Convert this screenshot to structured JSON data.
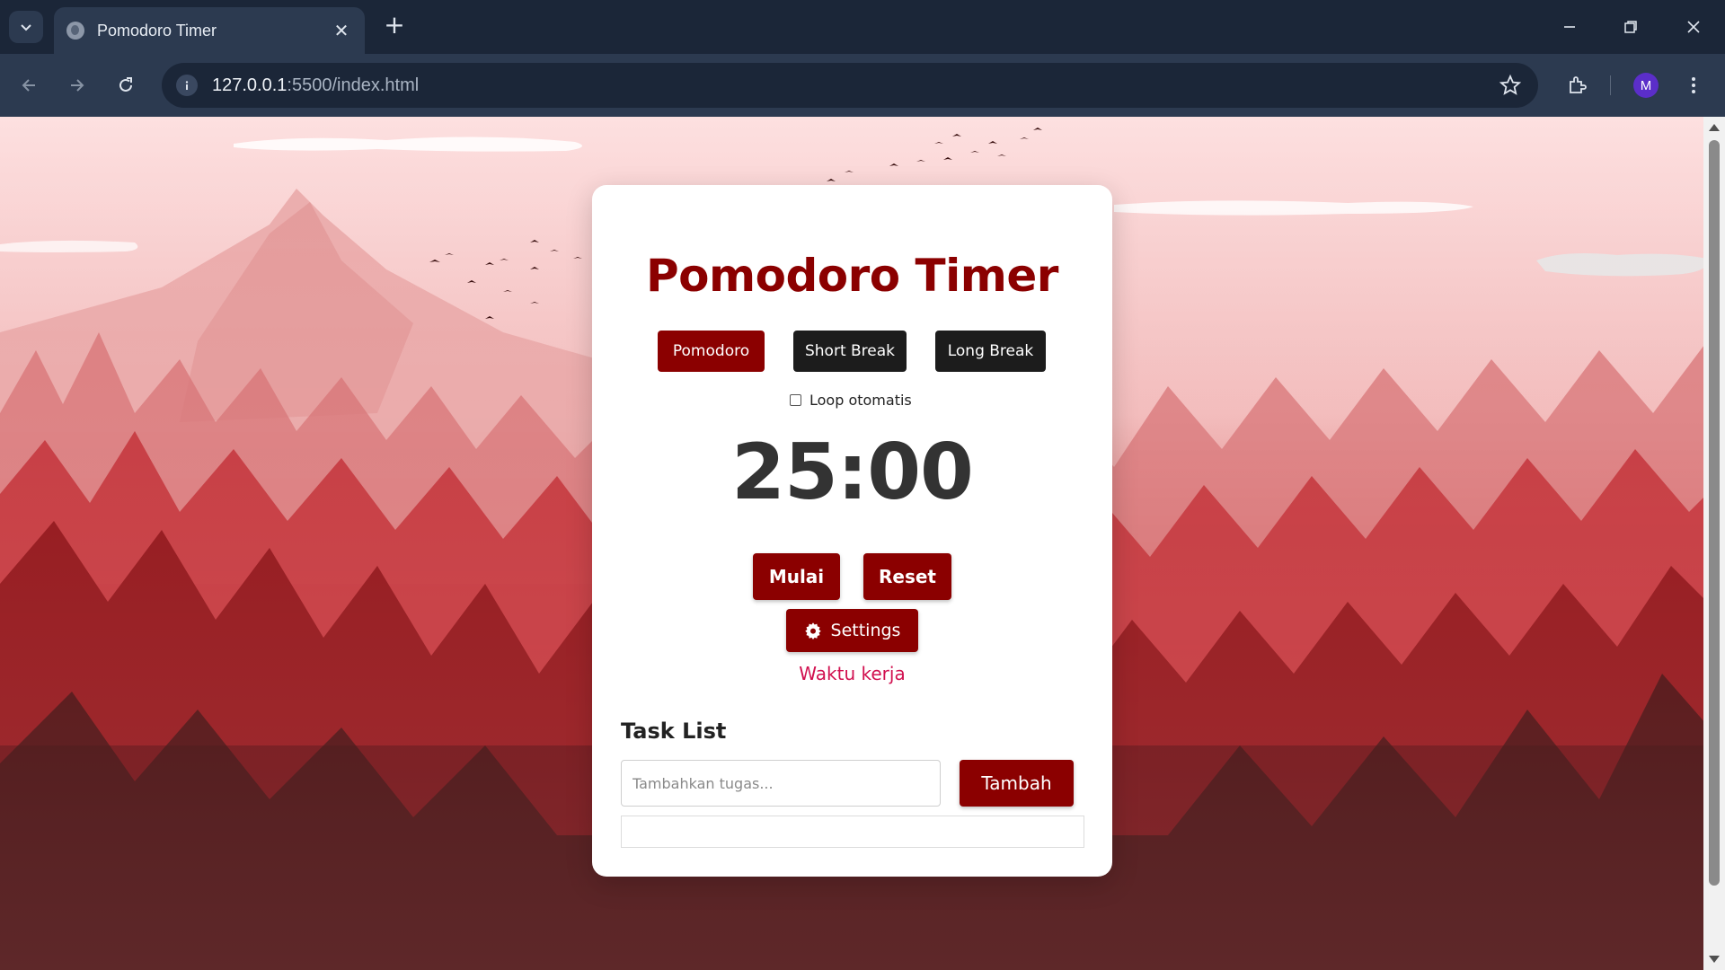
{
  "browser": {
    "tab_title": "Pomodoro Timer",
    "url_host": "127.0.0.1",
    "url_path": ":5500/index.html",
    "profile_initial": "M",
    "icons": [
      "tab-search-icon",
      "globe-icon",
      "close-icon",
      "plus-icon",
      "minimize-icon",
      "restore-icon",
      "window-close-icon",
      "back-icon",
      "forward-icon",
      "reload-icon",
      "info-icon",
      "star-icon",
      "extensions-icon",
      "kebab-menu-icon"
    ]
  },
  "app": {
    "title": "Pomodoro Timer",
    "modes": [
      {
        "label": "Pomodoro",
        "active": true
      },
      {
        "label": "Short Break",
        "active": false
      },
      {
        "label": "Long Break",
        "active": false
      }
    ],
    "loop": {
      "label": "Loop otomatis",
      "checked": false
    },
    "timer": "25:00",
    "start_label": "Mulai",
    "reset_label": "Reset",
    "settings_label": "Settings",
    "status": "Waktu kerja",
    "tasks": {
      "heading": "Task List",
      "input_placeholder": "Tambahkan tugas...",
      "add_label": "Tambah",
      "items": []
    }
  },
  "colors": {
    "accent": "#8b0000",
    "dark_button": "#1c1c1c",
    "status": "#d1104f",
    "timer": "#333333"
  }
}
